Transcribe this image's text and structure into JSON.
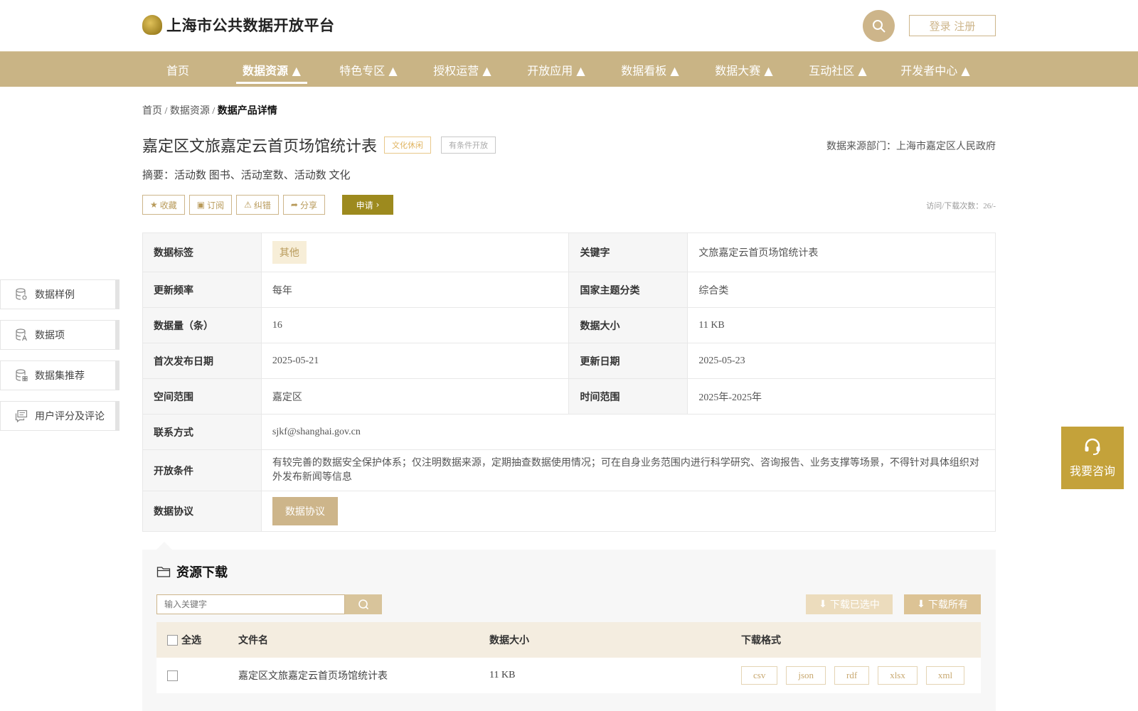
{
  "header": {
    "site_title": "上海市公共数据开放平台",
    "login_label": "登录 注册"
  },
  "nav": [
    {
      "label": "首页"
    },
    {
      "label": "数据资源 ▲"
    },
    {
      "label": "特色专区 ▲"
    },
    {
      "label": "授权运营 ▲"
    },
    {
      "label": "开放应用 ▲"
    },
    {
      "label": "数据看板 ▲"
    },
    {
      "label": "数据大赛 ▲"
    },
    {
      "label": "互动社区 ▲"
    },
    {
      "label": "开发者中心 ▲"
    }
  ],
  "breadcrumb": {
    "home": "首页",
    "sep": " / ",
    "section": "数据资源",
    "current": "数据产品详情"
  },
  "dataset": {
    "title": "嘉定区文旅嘉定云首页场馆统计表",
    "tag_category": "文化休闲",
    "tag_open": "有条件开放",
    "source": "数据来源部门：上海市嘉定区人民政府",
    "abstract": "摘要：活动数 图书、活动室数、活动数 文化"
  },
  "actions": {
    "collect": "收藏",
    "subscribe": "订阅",
    "correct": "纠错",
    "share": "分享",
    "apply": "申请",
    "visits": "访问/下载次数：26/-"
  },
  "info": {
    "tag_key": "数据标签",
    "tag_val": "其他",
    "keyword_key": "关键字",
    "keyword_val": "文旅嘉定云首页场馆统计表",
    "freq_key": "更新频率",
    "freq_val": "每年",
    "theme_key": "国家主题分类",
    "theme_val": "综合类",
    "count_key": "数据量（条）",
    "count_val": "16",
    "size_key": "数据大小",
    "size_val": "11 KB",
    "first_key": "首次发布日期",
    "first_val": "2025-05-21",
    "update_key": "更新日期",
    "update_val": "2025-05-23",
    "space_key": "空间范围",
    "space_val": "嘉定区",
    "time_key": "时间范围",
    "time_val": "2025年-2025年",
    "contact_key": "联系方式",
    "contact_val": "sjkf@shanghai.gov.cn",
    "cond_key": "开放条件",
    "cond_val": "有较完善的数据安全保护体系；仅注明数据来源，定期抽查数据使用情况；可在自身业务范围内进行科学研究、咨询报告、业务支撑等场景，不得针对具体组织对外发布新闻等信息",
    "protocol_key": "数据协议",
    "protocol_btn": "数据协议"
  },
  "side_menu": [
    {
      "label": "数据样例"
    },
    {
      "label": "数据项"
    },
    {
      "label": "数据集推荐"
    },
    {
      "label": "用户评分及评论"
    }
  ],
  "consult": {
    "label": "我要咨询"
  },
  "download": {
    "title": "资源下载",
    "search_placeholder": "输入关键字",
    "download_selected": "下载已选中",
    "download_all": "下载所有",
    "columns": {
      "select_all": "全选",
      "file_name": "文件名",
      "size": "数据大小",
      "format": "下载格式"
    },
    "rows": [
      {
        "file_name": "嘉定区文旅嘉定云首页场馆统计表",
        "size": "11 KB",
        "formats": [
          "csv",
          "json",
          "rdf",
          "xlsx",
          "xml"
        ]
      }
    ]
  }
}
